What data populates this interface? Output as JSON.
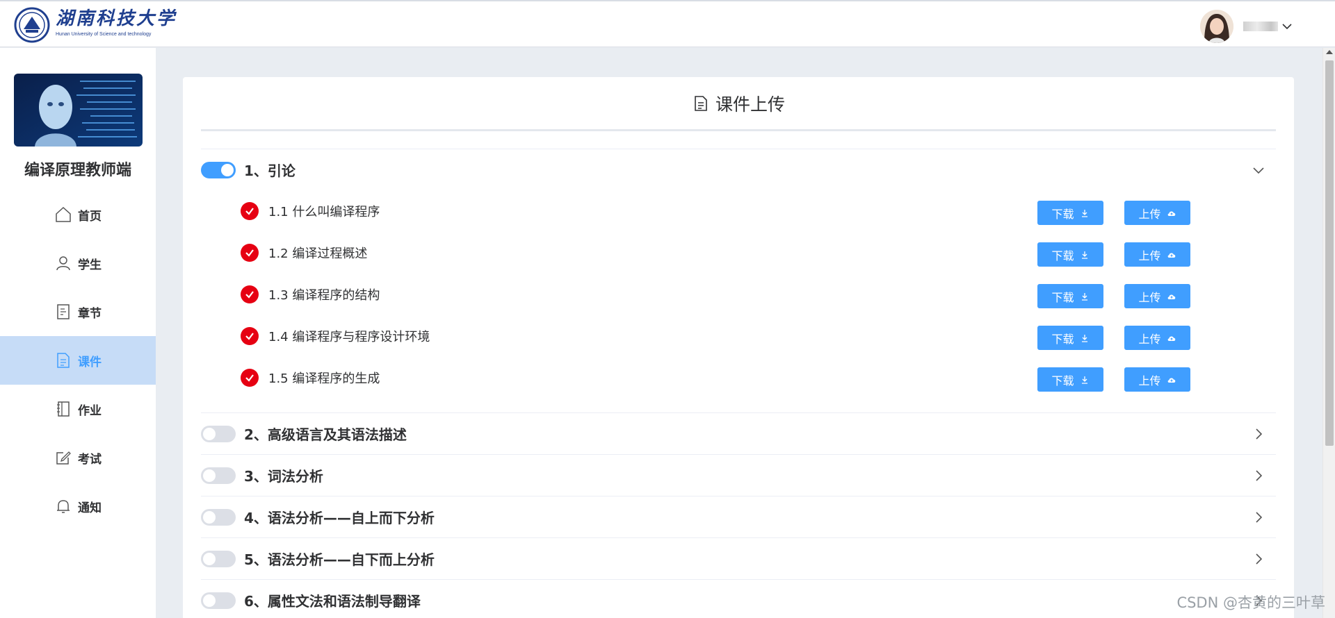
{
  "header": {
    "logo_cn": "湖南科技大学",
    "logo_en": "Hunan University of Science and technology"
  },
  "sidebar": {
    "title": "编译原理教师端",
    "items": [
      {
        "label": "首页",
        "icon": "home-icon"
      },
      {
        "label": "学生",
        "icon": "user-icon"
      },
      {
        "label": "章节",
        "icon": "document-icon"
      },
      {
        "label": "课件",
        "icon": "file-icon"
      },
      {
        "label": "作业",
        "icon": "notebook-icon"
      },
      {
        "label": "考试",
        "icon": "edit-icon"
      },
      {
        "label": "通知",
        "icon": "bell-icon"
      }
    ],
    "active_index": 3
  },
  "page": {
    "title": "课件上传"
  },
  "buttons": {
    "download": "下载",
    "upload": "上传"
  },
  "sections": [
    {
      "title": "1、引论",
      "expanded": true,
      "subsections": [
        "1.1 什么叫编译程序",
        "1.2 编译过程概述",
        "1.3 编译程序的结构",
        "1.4 编译程序与程序设计环境",
        "1.5 编译程序的生成"
      ]
    },
    {
      "title": "2、高级语言及其语法描述",
      "expanded": false
    },
    {
      "title": "3、词法分析",
      "expanded": false
    },
    {
      "title": "4、语法分析——自上而下分析",
      "expanded": false
    },
    {
      "title": "5、语法分析——自下而上分析",
      "expanded": false
    },
    {
      "title": "6、属性文法和语法制导翻译",
      "expanded": false
    }
  ],
  "watermark": "CSDN @杏黄的三叶草",
  "colors": {
    "primary": "#409eff",
    "check": "#e60012",
    "active_bg": "#c6dcf7"
  }
}
